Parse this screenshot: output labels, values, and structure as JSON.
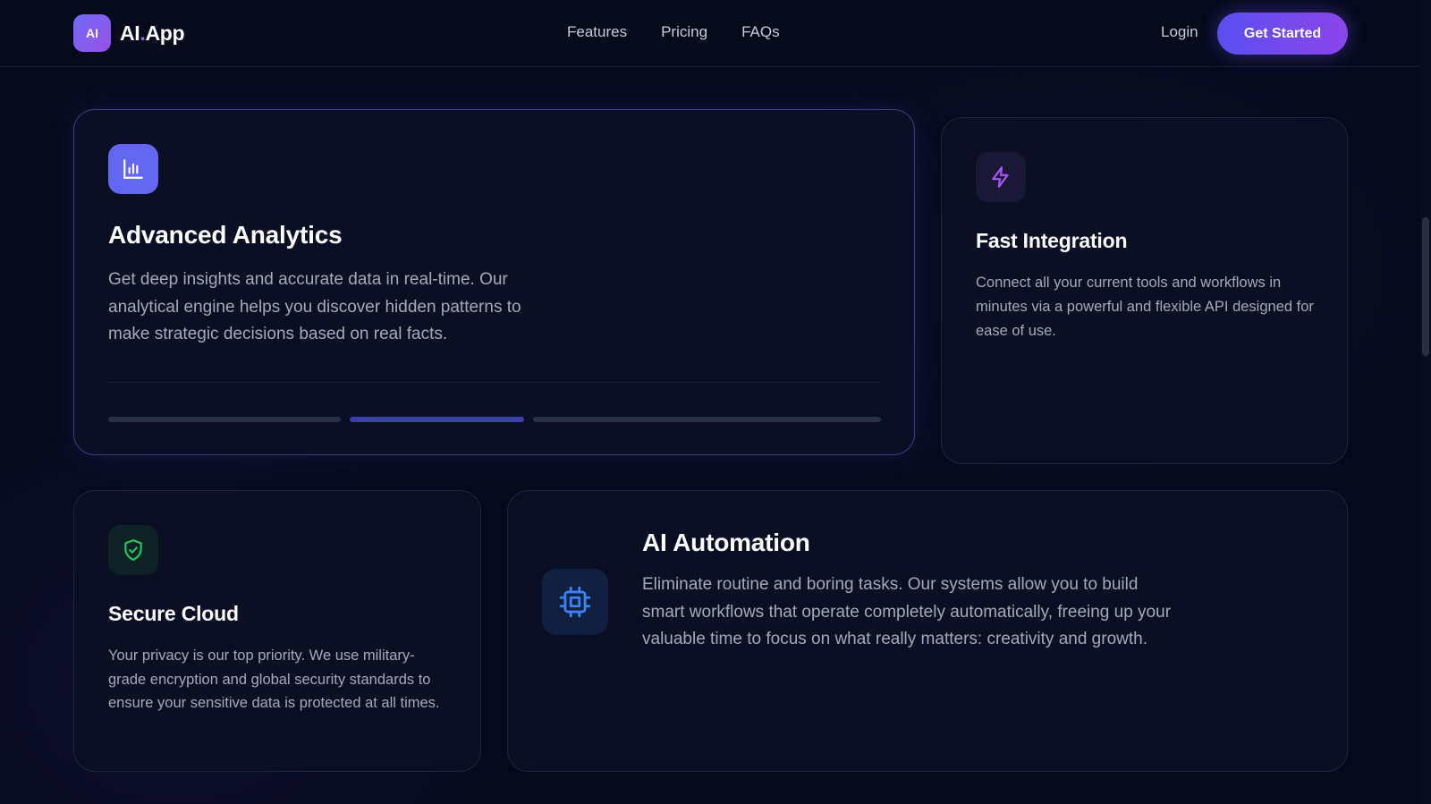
{
  "brand": {
    "badge": "AI",
    "name_part1": "AI",
    "name_dot": ".",
    "name_part2": "App"
  },
  "nav": {
    "links": [
      "Features",
      "Pricing",
      "FAQs"
    ],
    "login": "Login",
    "cta": "Get Started"
  },
  "cards": {
    "analytics": {
      "icon": "bar-chart-icon",
      "title": "Advanced Analytics",
      "description": "Get deep insights and accurate data in real-time. Our analytical engine helps you discover hidden patterns to make strategic decisions based on real facts.",
      "progress_segments": 3,
      "active_segment": 2
    },
    "integration": {
      "icon": "lightning-bolt-icon",
      "title": "Fast Integration",
      "description": "Connect all your current tools and workflows in minutes via a powerful and flexible API designed for ease of use."
    },
    "cloud": {
      "icon": "shield-check-icon",
      "title": "Secure Cloud",
      "description": "Your privacy is our top priority. We use military-grade encryption and global security standards to ensure your sensitive data is protected at all times."
    },
    "automation": {
      "icon": "cpu-chip-icon",
      "title": "AI Automation",
      "description": "Eliminate routine and boring tasks. Our systems allow you to build smart workflows that operate completely automatically, freeing up your valuable time to focus on what really matters: creativity and growth."
    }
  },
  "colors": {
    "background": "#060a1c",
    "card": "#0a0f24",
    "accent": "#6366f1",
    "accent_purple": "#8a45ea",
    "lightning": "#a855f7",
    "shield": "#22c55e",
    "chip": "#3b82f6"
  }
}
